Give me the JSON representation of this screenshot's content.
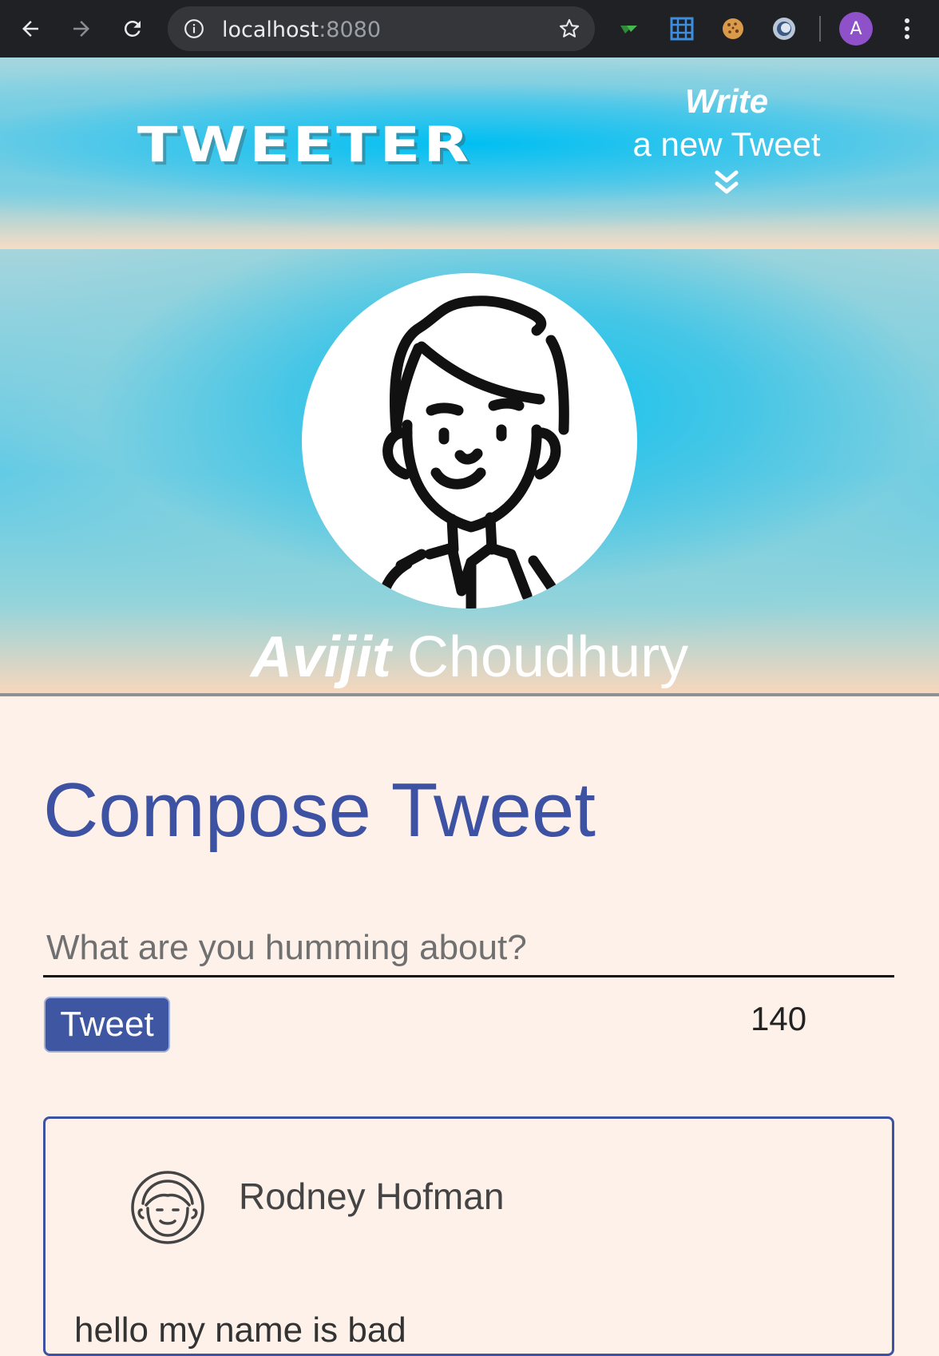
{
  "browser": {
    "url_host": "localhost",
    "url_port": ":8080",
    "profile_initial": "A"
  },
  "nav": {
    "logo": "TWEETER",
    "write_bold": "Write",
    "write_rest": "a new Tweet"
  },
  "profile": {
    "first_name": "Avijit",
    "last_name": "Choudhury"
  },
  "compose": {
    "title": "Compose Tweet",
    "placeholder": "What are you humming about?",
    "button_label": "Tweet",
    "counter": "140"
  },
  "tweets": [
    {
      "user_name": "Rodney Hofman",
      "text": "hello my name is bad"
    }
  ]
}
